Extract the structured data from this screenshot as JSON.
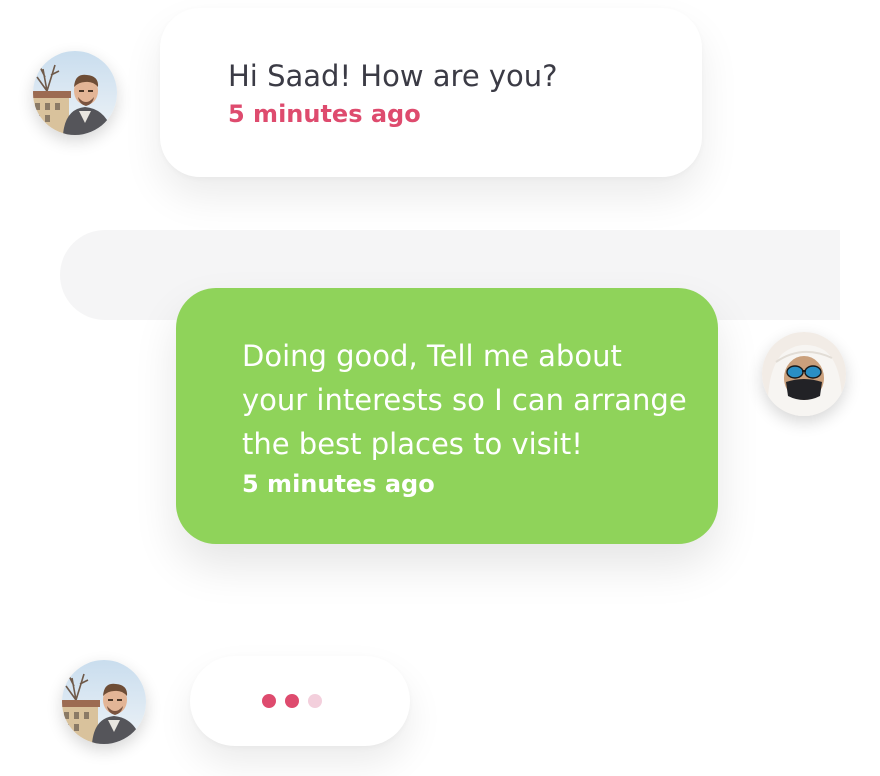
{
  "messages": [
    {
      "side": "incoming",
      "avatar": "man-selfie-avatar",
      "text": "Hi Saad! How are you?",
      "time": "5 minutes ago"
    },
    {
      "side": "outgoing",
      "avatar": "man-sunglasses-mask-avatar",
      "text": "Doing good, Tell me about your interests so I can arrange the best places to visit!",
      "time": "5 minutes ago"
    }
  ],
  "typing": {
    "avatar": "man-selfie-avatar",
    "dots": 3
  },
  "colors": {
    "incoming_bubble": "#ffffff",
    "outgoing_bubble": "#8fd35a",
    "timestamp_accent": "#de4b6e",
    "incoming_text": "#3b3b45",
    "typing_dot_active": "#de4b6e",
    "typing_dot_faded": "#f3cfdc"
  }
}
